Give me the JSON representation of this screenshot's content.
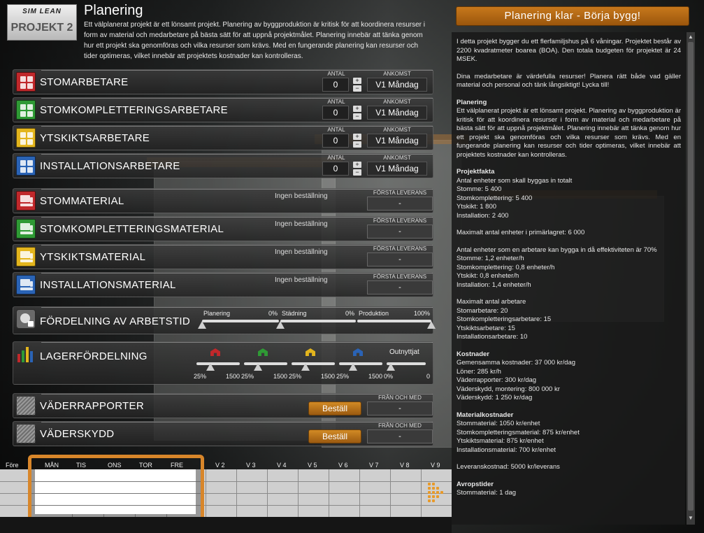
{
  "logo": {
    "line1": "SIM LEAN",
    "line2": "PROJEKT 2"
  },
  "header": {
    "title": "Planering",
    "intro": "Ett välplanerat projekt är ett lönsamt projekt. Planering av byggproduktion är kritisk för att koordinera resurser i form av material och medarbetare på bästa sätt för att uppnå projektmålet. Planering innebär att tänka genom hur ett projekt ska genomföras och vilka resurser som krävs. Med en fungerande planering kan resurser och tider optimeras, vilket innebär att projektets kostnader kan kontrolleras."
  },
  "labels": {
    "antal": "ANTAL",
    "ankomst": "ANKOMST",
    "forsta_leverans": "FÖRSTA LEVERANS",
    "fran_och_med": "FRÅN OCH MED",
    "plus": "+",
    "minus": "−"
  },
  "workers": [
    {
      "label": "STOMARBETARE",
      "count": "0",
      "arrival": "V1 Måndag",
      "color": "#c0282b"
    },
    {
      "label": "STOMKOMPLETTERINGSARBETARE",
      "count": "0",
      "arrival": "V1 Måndag",
      "color": "#2f9a35"
    },
    {
      "label": "YTSKIKTSARBETARE",
      "count": "0",
      "arrival": "V1 Måndag",
      "color": "#e3b51d"
    },
    {
      "label": "INSTALLATIONSARBETARE",
      "count": "0",
      "arrival": "V1 Måndag",
      "color": "#2a63b5"
    }
  ],
  "materials": [
    {
      "label": "STOMMATERIAL",
      "status": "Ingen beställning",
      "first_delivery": "-",
      "color": "#c0282b"
    },
    {
      "label": "STOMKOMPLETTERINGSMATERIAL",
      "status": "Ingen beställning",
      "first_delivery": "-",
      "color": "#2f9a35"
    },
    {
      "label": "YTSKIKTSMATERIAL",
      "status": "Ingen beställning",
      "first_delivery": "-",
      "color": "#e3b51d"
    },
    {
      "label": "INSTALLATIONSMATERIAL",
      "status": "Ingen beställning",
      "first_delivery": "-",
      "color": "#2a63b5"
    }
  ],
  "worktime": {
    "label": "FÖRDELNING AV ARBETSTID",
    "items": [
      {
        "name": "Planering",
        "value": "0%",
        "level": 0
      },
      {
        "name": "Städning",
        "value": "0%",
        "level": 0
      },
      {
        "name": "Produktion",
        "value": "100%",
        "level": 100
      }
    ]
  },
  "storage": {
    "label": "LAGERFÖRDELNING",
    "unused_label": "Outnyttjat",
    "sliders": [
      {
        "percent": "25%",
        "amount": "1500",
        "color": "#c0282b"
      },
      {
        "percent": "25%",
        "amount": "1500",
        "color": "#2f9a35"
      },
      {
        "percent": "25%",
        "amount": "1500",
        "color": "#e3b51d"
      },
      {
        "percent": "25%",
        "amount": "1500",
        "color": "#2a63b5"
      },
      {
        "percent": "0%",
        "amount": "0",
        "color": "#aaaaaa"
      }
    ]
  },
  "weather": [
    {
      "label": "VÄDERRAPPORTER",
      "button": "Beställ",
      "from": "-"
    },
    {
      "label": "VÄDERSKYDD",
      "button": "Beställ",
      "from": "-"
    }
  ],
  "right": {
    "top_button": "Planering klar - Börja bygg!",
    "paragraphs": [
      {
        "head": "",
        "text": "I detta projekt bygger du ett flerfamiljshus på 6 våningar. Projektet består av 2200 kvadratmeter boarea (BOA). Den totala budgeten för projektet är 24 MSEK."
      },
      {
        "head": "",
        "text": "Dina medarbetare är värdefulla resurser! Planera rätt både vad gäller material och personal och tänk långsiktigt! Lycka till!"
      },
      {
        "head": "Planering",
        "text": "Ett välplanerat projekt är ett lönsamt projekt. Planering av byggproduktion är kritisk för att koordinera resurser i form av material och medarbetare på bästa sätt för att uppnå projektmålet. Planering innebär att tänka genom hur ett projekt ska genomföras och vilka resurser som krävs. Med en fungerande planering kan resurser och tider optimeras, vilket innebär att projektets kostnader kan kontrolleras."
      }
    ],
    "facts": [
      {
        "head": "Projektfakta",
        "lines": [
          "Antal enheter som skall byggas in totalt",
          "Stomme: 5 400",
          "Stomkomplettering: 5 400",
          "Ytskikt: 1 800",
          "Installation: 2 400"
        ]
      },
      {
        "head": "",
        "lines": [
          "Maximalt antal enheter i primärlagret: 6 000"
        ]
      },
      {
        "head": "",
        "lines": [
          "Antal enheter som en arbetare kan bygga in då effektiviteten är 70%",
          "Stomme: 1,2 enheter/h",
          "Stomkomplettering: 0,8 enheter/h",
          "Ytskikt: 0,8 enheter/h",
          "Installation: 1,4 enheter/h"
        ]
      },
      {
        "head": "",
        "lines": [
          "Maximalt antal arbetare",
          "Stomarbetare: 20",
          "Stomkompletteringsarbetare: 15",
          "Ytskiktsarbetare: 15",
          "Installationsarbetare: 10"
        ]
      },
      {
        "head": "Kostnader",
        "lines": [
          "Gemensamma kostnader: 37 000 kr/dag",
          "Löner: 285 kr/h",
          "Väderrapporter: 300 kr/dag",
          "Väderskydd, montering: 800 000 kr",
          "Väderskydd: 1 250 kr/dag"
        ]
      },
      {
        "head": "Materialkostnader",
        "lines": [
          "Stommaterial: 1050 kr/enhet",
          "Stomkompletteringsmaterial: 875 kr/enhet",
          "Ytskiktsmaterial: 875 kr/enhet",
          "Installationsmaterial: 700 kr/enhet"
        ]
      },
      {
        "head": "",
        "lines": [
          "Leveranskostnad: 5000 kr/leverans"
        ]
      },
      {
        "head": "Avropstider",
        "lines": [
          "Stommaterial: 1 dag"
        ]
      }
    ]
  },
  "timeline": {
    "before": "Före",
    "days": [
      "MÅN",
      "TIS",
      "ONS",
      "TOR",
      "FRE"
    ],
    "weeks": [
      "V 2",
      "V 3",
      "V 4",
      "V 5",
      "V 6",
      "V 7",
      "V 8",
      "V 9"
    ]
  }
}
